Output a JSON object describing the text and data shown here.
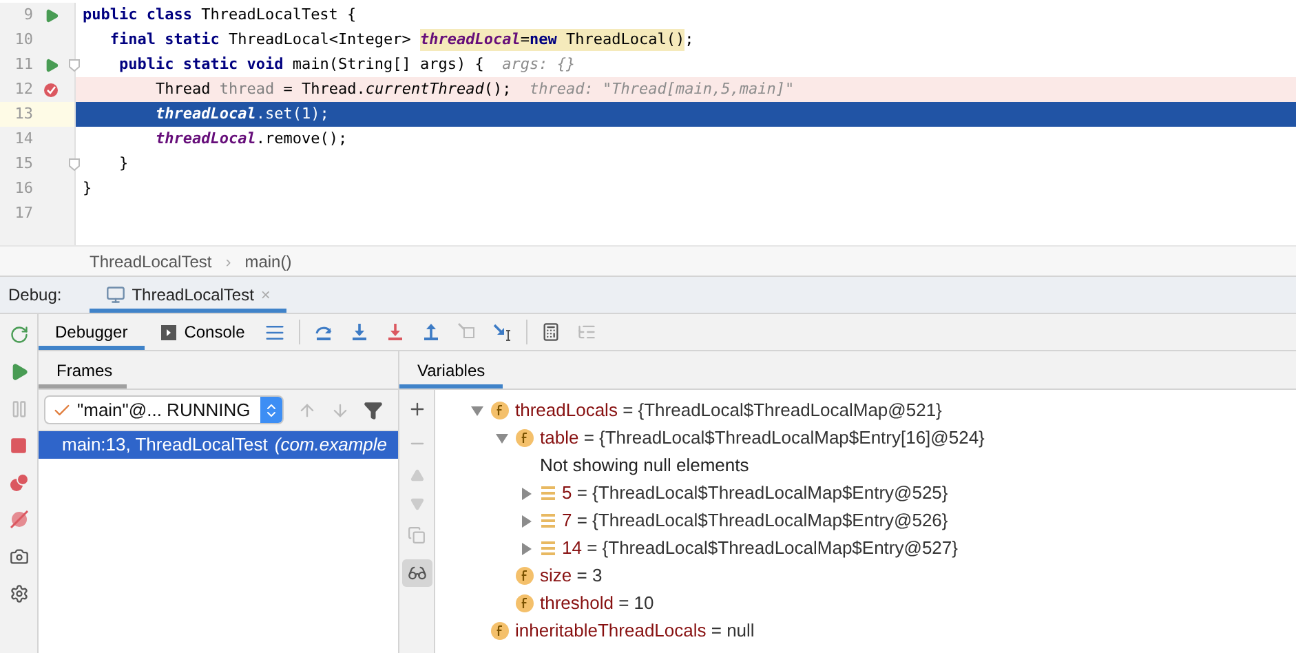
{
  "editor": {
    "lines": [
      {
        "number": "9",
        "run_marker": true,
        "breakpoint": false,
        "execution": false,
        "caret": false,
        "fold": false,
        "tokens": [
          {
            "text": "public class ",
            "kind": "kw",
            "highlight": false
          },
          {
            "text": "ThreadLocalTest {",
            "kind": "plain",
            "highlight": false
          }
        ]
      },
      {
        "number": "10",
        "run_marker": false,
        "breakpoint": false,
        "execution": false,
        "caret": false,
        "fold": false,
        "tokens": [
          {
            "text": "   final static ",
            "kind": "kw",
            "highlight": false
          },
          {
            "text": "ThreadLocal<Integer> ",
            "kind": "plain",
            "highlight": false
          },
          {
            "text": "threadLocal",
            "kind": "field",
            "highlight": true
          },
          {
            "text": "=",
            "kind": "plain",
            "highlight": true
          },
          {
            "text": "new ",
            "kind": "kw",
            "highlight": true
          },
          {
            "text": "ThreadLocal()",
            "kind": "plain",
            "highlight": true
          },
          {
            "text": ";",
            "kind": "plain",
            "highlight": false
          }
        ]
      },
      {
        "number": "11",
        "run_marker": true,
        "breakpoint": false,
        "execution": false,
        "caret": false,
        "fold": true,
        "tokens": [
          {
            "text": "    public static void ",
            "kind": "kw",
            "highlight": false
          },
          {
            "text": "main(String[] args) {  ",
            "kind": "plain",
            "highlight": false
          },
          {
            "text": "args: {}",
            "kind": "hint",
            "highlight": false
          }
        ]
      },
      {
        "number": "12",
        "run_marker": false,
        "breakpoint": true,
        "execution": false,
        "caret": false,
        "fold": false,
        "tokens": [
          {
            "text": "        Thread ",
            "kind": "plain",
            "highlight": false
          },
          {
            "text": "thread",
            "kind": "local",
            "highlight": false
          },
          {
            "text": " = Thread.",
            "kind": "plain",
            "highlight": false
          },
          {
            "text": "currentThread",
            "kind": "italic",
            "highlight": false
          },
          {
            "text": "();  ",
            "kind": "plain",
            "highlight": false
          },
          {
            "text": "thread: \"Thread[main,5,main]\"",
            "kind": "hint",
            "highlight": false
          }
        ]
      },
      {
        "number": "13",
        "run_marker": false,
        "breakpoint": false,
        "execution": true,
        "caret": true,
        "fold": false,
        "tokens": [
          {
            "text": "        threadLocal",
            "kind": "field",
            "highlight": false
          },
          {
            "text": ".set(1);",
            "kind": "plain",
            "highlight": false
          }
        ]
      },
      {
        "number": "14",
        "run_marker": false,
        "breakpoint": false,
        "execution": false,
        "caret": false,
        "fold": false,
        "tokens": [
          {
            "text": "        threadLocal",
            "kind": "field",
            "highlight": false
          },
          {
            "text": ".remove();",
            "kind": "plain",
            "highlight": false
          }
        ]
      },
      {
        "number": "15",
        "run_marker": false,
        "breakpoint": false,
        "execution": false,
        "caret": false,
        "fold": true,
        "tokens": [
          {
            "text": "    }",
            "kind": "plain",
            "highlight": false
          }
        ]
      },
      {
        "number": "16",
        "run_marker": false,
        "breakpoint": false,
        "execution": false,
        "caret": false,
        "fold": false,
        "tokens": [
          {
            "text": "}",
            "kind": "plain",
            "highlight": false
          }
        ]
      },
      {
        "number": "17",
        "run_marker": false,
        "breakpoint": false,
        "execution": false,
        "caret": false,
        "fold": false
      }
    ]
  },
  "breadcrumbs": [
    "ThreadLocalTest",
    "main()"
  ],
  "breadcrumb_separator": "›",
  "debug": {
    "label": "Debug:",
    "session_tab": "ThreadLocalTest",
    "close": "×"
  },
  "tool_tabs": [
    {
      "label": "Debugger",
      "selected": true
    },
    {
      "label": "Console",
      "selected": false
    }
  ],
  "frames": {
    "title": "Frames",
    "thread": "\"main\"@... RUNNING",
    "items": [
      {
        "location": "main:13, ThreadLocalTest",
        "package": "(com.example",
        "selected": true
      }
    ]
  },
  "variables": {
    "title": "Variables",
    "tree": [
      {
        "kind": "field",
        "name": "threadLocals",
        "value": " = {ThreadLocal$ThreadLocalMap@521}",
        "expanded": true,
        "children": [
          {
            "kind": "field",
            "name": "table",
            "value": " = {ThreadLocal$ThreadLocalMap$Entry[16]@524}",
            "expanded": true,
            "children": [
              {
                "kind": "message",
                "name": "Not showing null elements"
              },
              {
                "kind": "element",
                "name": "5",
                "value": " = {ThreadLocal$ThreadLocalMap$Entry@525}",
                "expanded": false
              },
              {
                "kind": "element",
                "name": "7",
                "value": " = {ThreadLocal$ThreadLocalMap$Entry@526}",
                "expanded": false
              },
              {
                "kind": "element",
                "name": "14",
                "value": " = {ThreadLocal$ThreadLocalMap$Entry@527}",
                "expanded": false
              }
            ]
          },
          {
            "kind": "field",
            "name": "size",
            "value": " = 3"
          },
          {
            "kind": "field",
            "name": "threshold",
            "value": " = 10"
          }
        ]
      },
      {
        "kind": "field",
        "name": "inheritableThreadLocals",
        "value": " = null"
      }
    ]
  }
}
